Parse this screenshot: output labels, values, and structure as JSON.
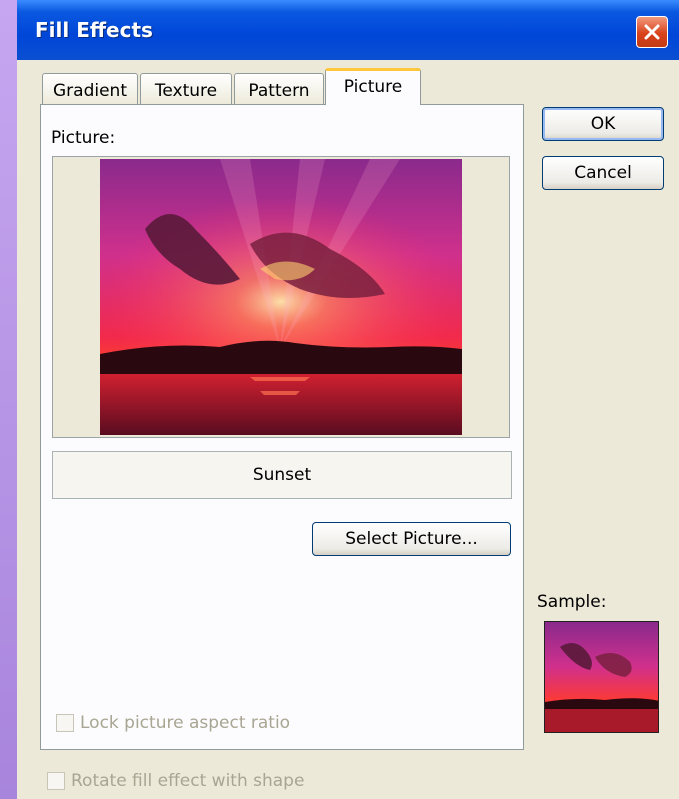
{
  "window": {
    "title": "Fill Effects"
  },
  "tabs": [
    "Gradient",
    "Texture",
    "Pattern",
    "Picture"
  ],
  "active_tab": "Picture",
  "picture": {
    "label": "Picture:",
    "name": "Sunset"
  },
  "buttons": {
    "select_picture": "Select Picture...",
    "ok": "OK",
    "cancel": "Cancel"
  },
  "lock_aspect": {
    "label": "Lock picture aspect ratio",
    "checked": false
  },
  "rotate_fill": {
    "label": "Rotate fill effect with shape",
    "checked": false
  },
  "sample": {
    "label": "Sample:"
  },
  "colors": {
    "titlebar": "#0046d8",
    "tab_highlight": "#ffc73c",
    "dialog_bg": "#ece9d8"
  }
}
